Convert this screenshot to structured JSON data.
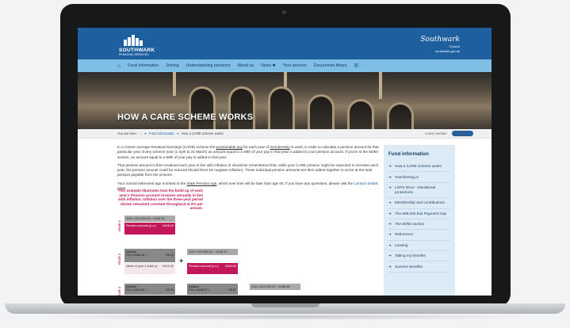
{
  "header": {
    "logo_text": "SOUTHWARK",
    "logo_sub": "PENSIONS SERVICES",
    "council_script": "Southwark",
    "council_sub_a": "Council",
    "council_sub_b": "southwark.gov.uk"
  },
  "nav": {
    "items": [
      "Fund information",
      "Joining",
      "Understanding pensions",
      "About us",
      "News ✱",
      "Your pension",
      "Documents library"
    ]
  },
  "hero": {
    "title": "HOW A CARE SCHEME WORKS"
  },
  "breadcrumb": {
    "prefix": "You are here:",
    "home_label": "⌂",
    "sep": "➜",
    "link": "Fund information",
    "current": "How a CARE scheme works",
    "active_label": "Active member",
    "change_label": "Change ➜"
  },
  "content": {
    "p1_a": "In a Career Average Revalued Earnings (CARE) scheme the ",
    "p1_u1": "pensionable pay",
    "p1_b": " for each year of ",
    "p1_u2": "membership",
    "p1_c": " is used, in order to calculate a pension amount for that particular year. Every scheme year (1 April to 31 March) an amount equal to a 49th of your pay in that year is added to your pension account. If you're in the 50/50 section, an amount equal to a 98th of your pay is added in that year.",
    "p2": "That pension amount is then revalued each year in line with inflation (it should be remembered that, while your CARE pension might be expected to increase each year, the pension amount could be reduced should there be negative inflation). These individual pension amounts are then added together to arrive at the total pension payable from the scheme.",
    "p3_a": "Your normal retirement age is linked to the ",
    "p3_u": "State Pension Age",
    "p3_b": ", which ever time will be later than age 65. If you have any questions, please visit the ",
    "p3_link": "Contact details",
    "p3_c": " page."
  },
  "diagram": {
    "note": "This example illustrates how the build up of each year's Pension account revalues annually in line with inflation. Inflation over the three-year period shown remained constant throughout at 2% per annum.",
    "year1": "YEAR 1",
    "year2": "YEAR 2",
    "year3": "YEAR 3",
    "y1_calc": "1/49 x £20,000.00 = £408.16",
    "y1_pension": "Pension account (p.a.)",
    "y1_amount": "£408.16",
    "y2_infl": "Inflation",
    "y2_infl_calc": "2% x £408.16 =",
    "y2_infl_amt": "£8.16",
    "y2_value": "Value of year 1 build up",
    "y2_value_amt": "£416.32",
    "plus": "+",
    "y2_calc": "1/49 x £20,500.00 = £418.37",
    "y2_pension": "Pension account (p.a.)",
    "y2_amount": "£834.69",
    "y3_infl": "Inflation",
    "y3_infl_calc": "2% x £416.32 =",
    "y3_infl_amt": "£8.33",
    "y3_infl_b": "Inflation",
    "y3_infl_calc_b": "2% x £418.37 =",
    "y3_infl_amt_b": "£8.37",
    "y3_calc": "1/49 x £22,000.00 = £448.98"
  },
  "sidebar": {
    "title": "Fund information",
    "items": [
      "How a CARE scheme works",
      "Transferring in",
      "LGPS 2014 - transitional protections",
      "Membership and contributions",
      "The £95,000 Exit Payment Cap",
      "The 50/50 section",
      "Retirement",
      "Leaving",
      "Taking my benefits",
      "Survivor benefits"
    ]
  }
}
